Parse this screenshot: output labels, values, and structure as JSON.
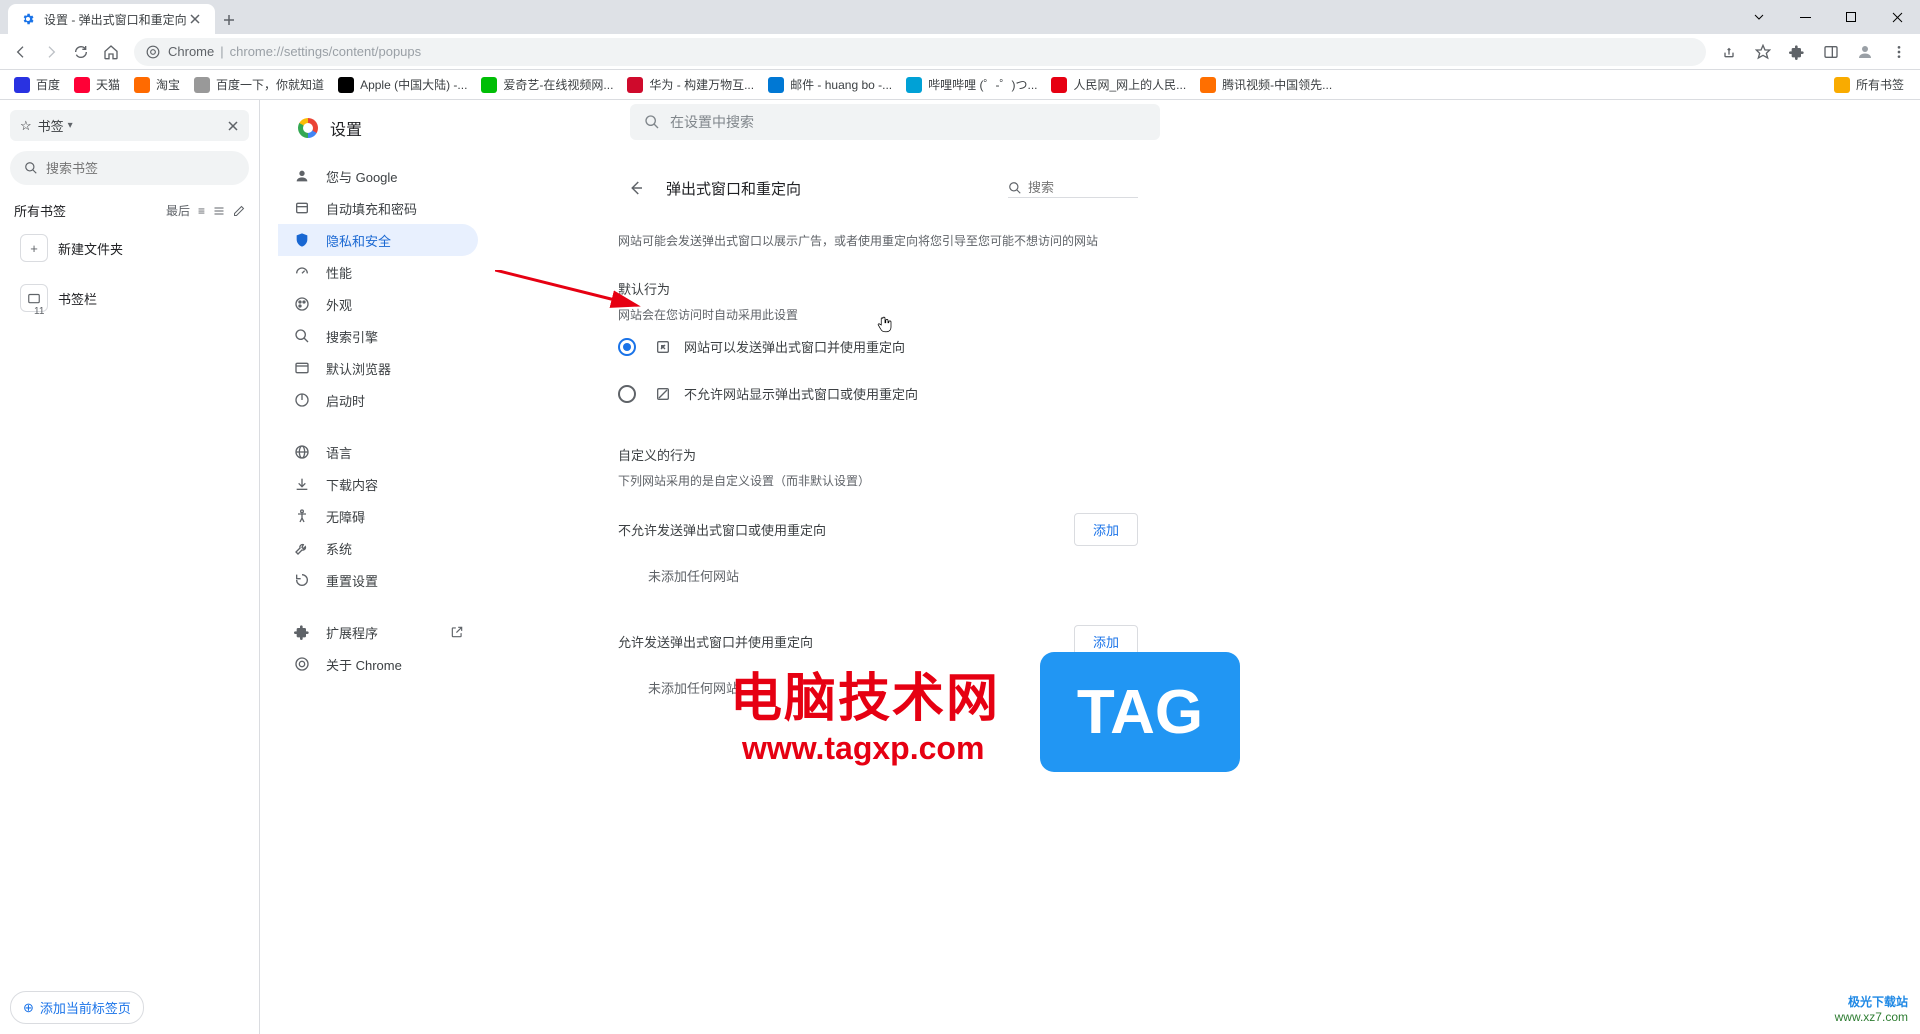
{
  "tab": {
    "title": "设置 - 弹出式窗口和重定向"
  },
  "url": {
    "chrome_label": "Chrome",
    "path": "chrome://settings/content/popups"
  },
  "bookmarks_bar": {
    "items": [
      {
        "label": "百度",
        "color": "#2932e1"
      },
      {
        "label": "天猫",
        "color": "#ff0036"
      },
      {
        "label": "淘宝",
        "color": "#ff6a00"
      },
      {
        "label": "百度一下，你就知道",
        "color": "#999"
      },
      {
        "label": "Apple (中国大陆) -...",
        "color": "#000"
      },
      {
        "label": "爱奇艺-在线视频网...",
        "color": "#00be06"
      },
      {
        "label": "华为 - 构建万物互...",
        "color": "#cf0a2c"
      },
      {
        "label": "邮件 - huang bo -...",
        "color": "#0078d4"
      },
      {
        "label": "哔哩哔哩 (゜-゜)つ...",
        "color": "#00a1d6"
      },
      {
        "label": "人民网_网上的人民...",
        "color": "#e60012"
      },
      {
        "label": "腾讯视频-中国领先...",
        "color": "#ff6f00"
      }
    ],
    "all_label": "所有书签"
  },
  "bookmarks_panel": {
    "header_label": "书签",
    "search_placeholder": "搜索书签",
    "all_bookmarks": "所有书签",
    "sort_label": "最后",
    "new_folder": "新建文件夹",
    "bookmark_bar": "书签栏",
    "count": "11",
    "add_current": "添加当前标签页"
  },
  "settings": {
    "title": "设置",
    "search_placeholder": "在设置中搜索",
    "nav": [
      {
        "label": "您与 Google",
        "icon": "person"
      },
      {
        "label": "自动填充和密码",
        "icon": "autofill"
      },
      {
        "label": "隐私和安全",
        "icon": "shield",
        "active": true
      },
      {
        "label": "性能",
        "icon": "speed"
      },
      {
        "label": "外观",
        "icon": "palette"
      },
      {
        "label": "搜索引擎",
        "icon": "search"
      },
      {
        "label": "默认浏览器",
        "icon": "browser"
      },
      {
        "label": "启动时",
        "icon": "power"
      }
    ],
    "nav2": [
      {
        "label": "语言",
        "icon": "globe"
      },
      {
        "label": "下载内容",
        "icon": "download"
      },
      {
        "label": "无障碍",
        "icon": "access"
      },
      {
        "label": "系统",
        "icon": "wrench"
      },
      {
        "label": "重置设置",
        "icon": "reset"
      }
    ],
    "nav3": [
      {
        "label": "扩展程序",
        "icon": "ext",
        "external": true
      },
      {
        "label": "关于 Chrome",
        "icon": "chrome"
      }
    ]
  },
  "page": {
    "title": "弹出式窗口和重定向",
    "search_placeholder": "搜索",
    "description": "网站可能会发送弹出式窗口以展示广告，或者使用重定向将您引导至您可能不想访问的网站",
    "default_h": "默认行为",
    "default_sub": "网站会在您访问时自动采用此设置",
    "radio_allow": "网站可以发送弹出式窗口并使用重定向",
    "radio_block": "不允许网站显示弹出式窗口或使用重定向",
    "custom_h": "自定义的行为",
    "custom_sub": "下列网站采用的是自定义设置（而非默认设置）",
    "block_section": "不允许发送弹出式窗口或使用重定向",
    "allow_section": "允许发送弹出式窗口并使用重定向",
    "add_btn": "添加",
    "none_text": "未添加任何网站"
  },
  "watermark": {
    "text": "电脑技术网",
    "url": "www.tagxp.com",
    "tag": "TAG",
    "corner1": "极光下载站",
    "corner2": "www.xz7.com"
  }
}
